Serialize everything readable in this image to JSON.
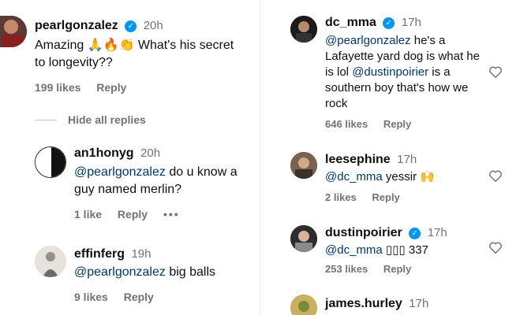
{
  "left": {
    "c1": {
      "username": "pearlgonzalez",
      "time": "20h",
      "text_a": "Amazing 🙏🔥👏 What's his secret",
      "text_b": "to longevity??",
      "likes": "199 likes",
      "reply": "Reply"
    },
    "hide_replies": "Hide all replies",
    "c2": {
      "username": "an1honyg",
      "time": "20h",
      "mention": "@pearlgonzalez",
      "text_a": " do u know a",
      "text_b": "guy named merlin?",
      "likes": "1 like",
      "reply": "Reply",
      "more": "•••"
    },
    "c3": {
      "username": "effinferg",
      "time": "19h",
      "mention": "@pearlgonzalez",
      "text": " big balls",
      "likes": "9 likes",
      "reply": "Reply"
    }
  },
  "right": {
    "c1": {
      "username": "dc_mma",
      "time": "17h",
      "mention1": "@pearlgonzalez",
      "t1": " he's a",
      "t2": "Lafayette yard dog is what he",
      "t3a": "is lol ",
      "mention2": "@dustinpoirier",
      "t3b": " is a",
      "t4": "southern boy that's how we",
      "t5": "rock",
      "likes": "646 likes",
      "reply": "Reply"
    },
    "c2": {
      "username": "leesephine",
      "time": "17h",
      "mention": "@dc_mma",
      "text": " yessir 🙌",
      "likes": "2 likes",
      "reply": "Reply"
    },
    "c3": {
      "username": "dustinpoirier",
      "time": "17h",
      "mention": "@dc_mma",
      "text": " ▯▯▯ 337",
      "likes": "253 likes",
      "reply": "Reply"
    },
    "c4": {
      "username": "james.hurley",
      "time": "17h"
    }
  },
  "colors": {
    "verified": "#0095f6",
    "mention": "#00376b",
    "muted": "#737373"
  },
  "icons": [
    "verified-badge-icon",
    "heart-icon",
    "more-options-icon"
  ]
}
